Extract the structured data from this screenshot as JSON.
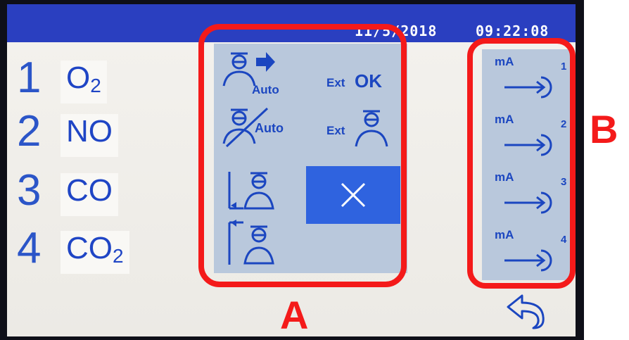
{
  "status": {
    "date": "11/5/2018",
    "time": "09:22:08"
  },
  "channels": [
    {
      "num": "1",
      "gas": "O",
      "sub": "2"
    },
    {
      "num": "2",
      "gas": "NO",
      "sub": ""
    },
    {
      "num": "3",
      "gas": "CO",
      "sub": ""
    },
    {
      "num": "4",
      "gas": "CO",
      "sub": "2"
    }
  ],
  "menu": {
    "auto_label": "Auto",
    "ext_ok_ext": "Ext",
    "ext_ok_ok": "OK",
    "auto_off_label": "Auto",
    "ext_label": "Ext",
    "icons": {
      "auto_cal": "person-arrow-auto-icon",
      "ext_ok": "ext-ok-icon",
      "auto_off": "person-auto-crossed-icon",
      "ext_cal": "ext-person-icon",
      "range_low": "axis-low-person-icon",
      "range_high": "axis-high-person-icon",
      "close": "close-icon"
    }
  },
  "outputs": [
    {
      "unit": "mA",
      "num": "1"
    },
    {
      "unit": "mA",
      "num": "2"
    },
    {
      "unit": "mA",
      "num": "3"
    },
    {
      "unit": "mA",
      "num": "4"
    }
  ],
  "back_icon": "back-arrow-icon",
  "annotations": {
    "a": "A",
    "b": "B",
    "color": "#f41a1a"
  },
  "colors": {
    "accent": "#2f63df",
    "status_bar": "#2a3fc0",
    "panel": "#b9c8dc",
    "text": "#1b46c0"
  }
}
